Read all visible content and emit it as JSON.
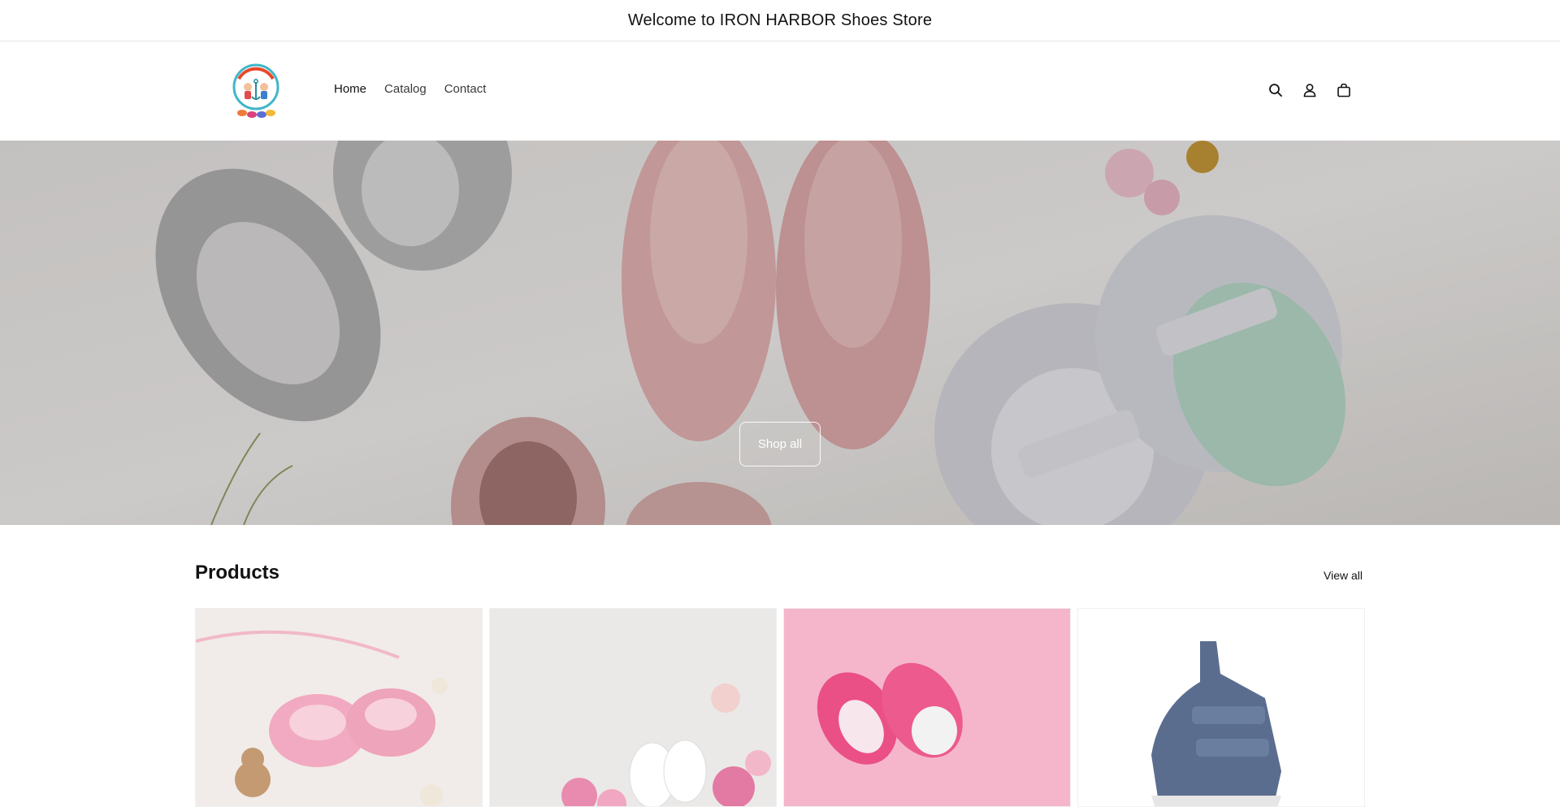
{
  "announcement": {
    "text": "Welcome to IRON HARBOR Shoes Store"
  },
  "header": {
    "logo_icon": "store-logo-kids-anchor",
    "nav": [
      {
        "label": "Home",
        "active": true
      },
      {
        "label": "Catalog",
        "active": false
      },
      {
        "label": "Contact",
        "active": false
      }
    ],
    "icons": [
      "search-icon",
      "account-icon",
      "cart-icon"
    ]
  },
  "hero": {
    "image": "baby-shoes-on-white-fur",
    "button_label": "Shop all"
  },
  "products": {
    "title": "Products",
    "view_all_label": "View all",
    "items": [
      {
        "image": "pink-ruffle-baby-shoes-with-teddy"
      },
      {
        "image": "white-baby-sandals-with-flowers"
      },
      {
        "image": "pink-baby-sneakers-on-pink"
      },
      {
        "image": "blue-denim-velcro-sneaker"
      }
    ]
  },
  "colors": {
    "text": "#121212",
    "border": "#e6e6e6",
    "hero_button_border": "#ffffff"
  }
}
